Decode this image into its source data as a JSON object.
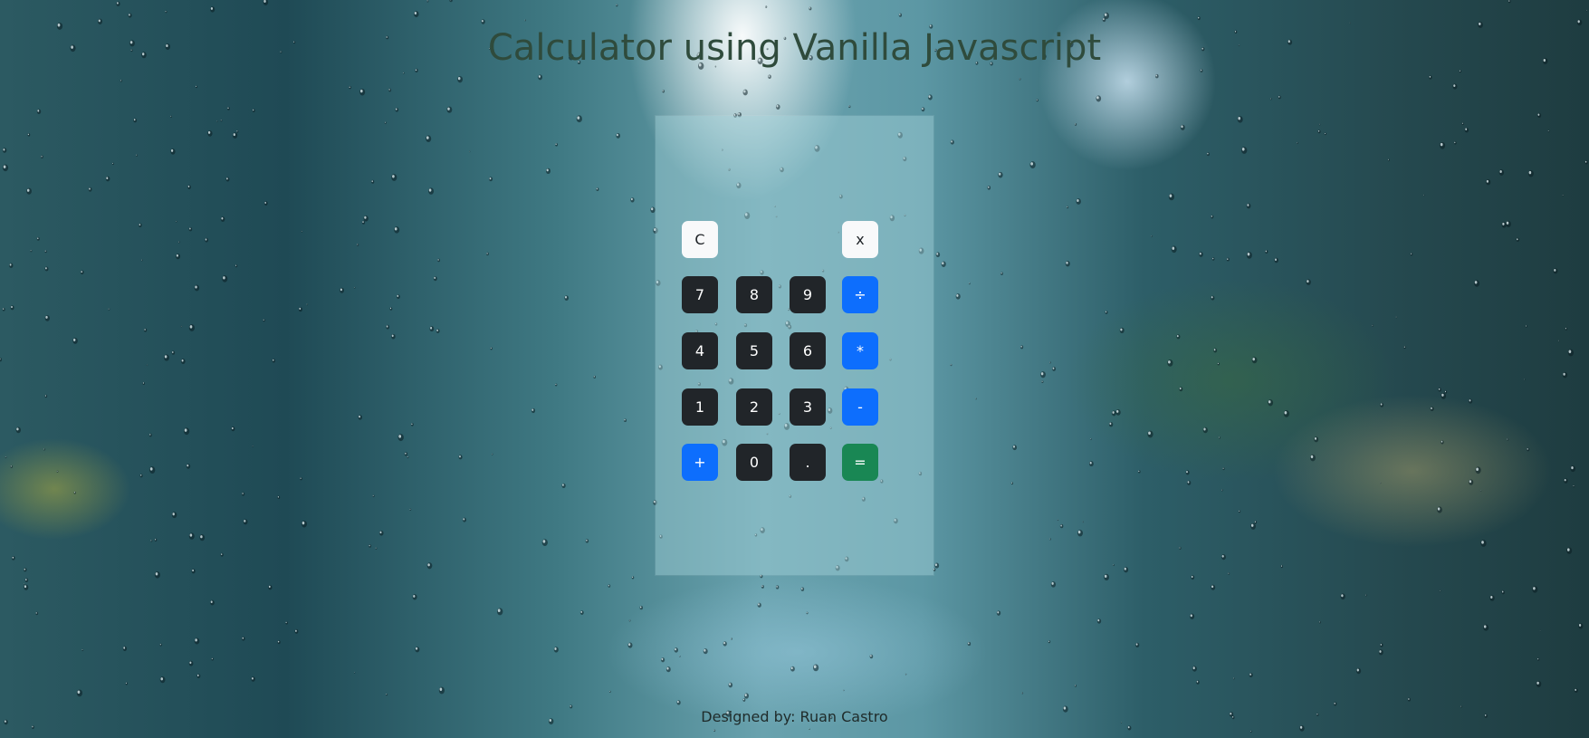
{
  "page": {
    "title": "Calculator using Vanilla Javascript",
    "footer": "Designed by: Ruan Castro"
  },
  "calculator": {
    "clear_label": "C",
    "backspace_label": "x",
    "keys": {
      "seven": "7",
      "eight": "8",
      "nine": "9",
      "divide": "÷",
      "four": "4",
      "five": "5",
      "six": "6",
      "multiply": "*",
      "one": "1",
      "two": "2",
      "three": "3",
      "subtract": "-",
      "add": "+",
      "zero": "0",
      "decimal": ".",
      "equals": "="
    }
  },
  "colors": {
    "title": "#2f4b3c",
    "number_key": "#212529",
    "operator_key": "#0d6efd",
    "equals_key": "#198754",
    "utility_key": "#f8f9fa"
  }
}
